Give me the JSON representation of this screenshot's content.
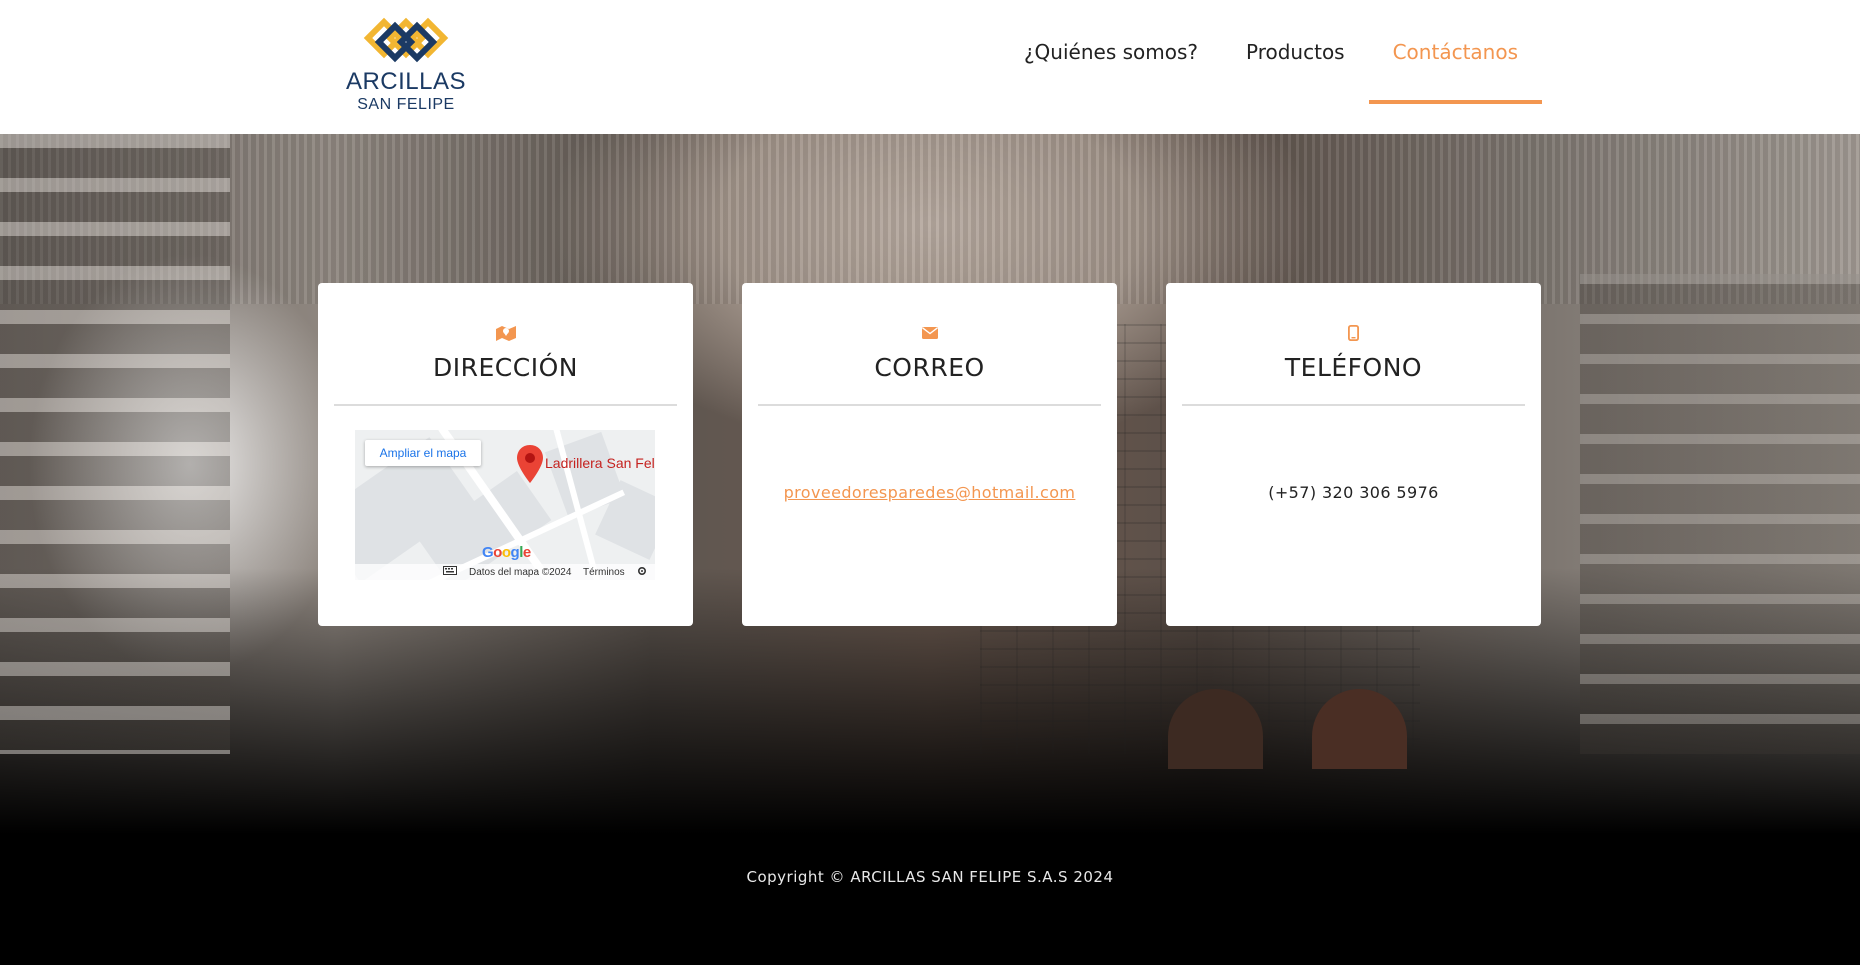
{
  "brand": {
    "line1": "ARCILLAS",
    "line2": "SAN FELIPE",
    "colors": {
      "navy": "#1b3a64",
      "gold": "#f2b632"
    }
  },
  "nav": {
    "items": [
      {
        "label": "¿Quiénes somos?",
        "active": false
      },
      {
        "label": "Productos",
        "active": false
      },
      {
        "label": "Contáctanos",
        "active": true
      }
    ],
    "active_color": "#f39650"
  },
  "cards": {
    "address": {
      "icon": "map-icon",
      "title": "DIRECCIÓN",
      "map": {
        "expand_label": "Ampliar el mapa",
        "place_label": "Ladrillera San Feli",
        "google_label": "Google",
        "attribution": "Datos del mapa ©2024",
        "terms": "Términos",
        "pin_icon": "map-pin-icon",
        "keyboard_icon": "keyboard-icon",
        "settings_icon": "gear-icon"
      }
    },
    "email": {
      "icon": "envelope-icon",
      "title": "CORREO",
      "value": "proveedoresparedes@hotmail.com"
    },
    "phone": {
      "icon": "mobile-phone-icon",
      "title": "TELÉFONO",
      "value": "(+57) 320 306 5976"
    }
  },
  "footer": {
    "copyright": "Copyright © ARCILLAS SAN FELIPE S.A.S 2024"
  }
}
